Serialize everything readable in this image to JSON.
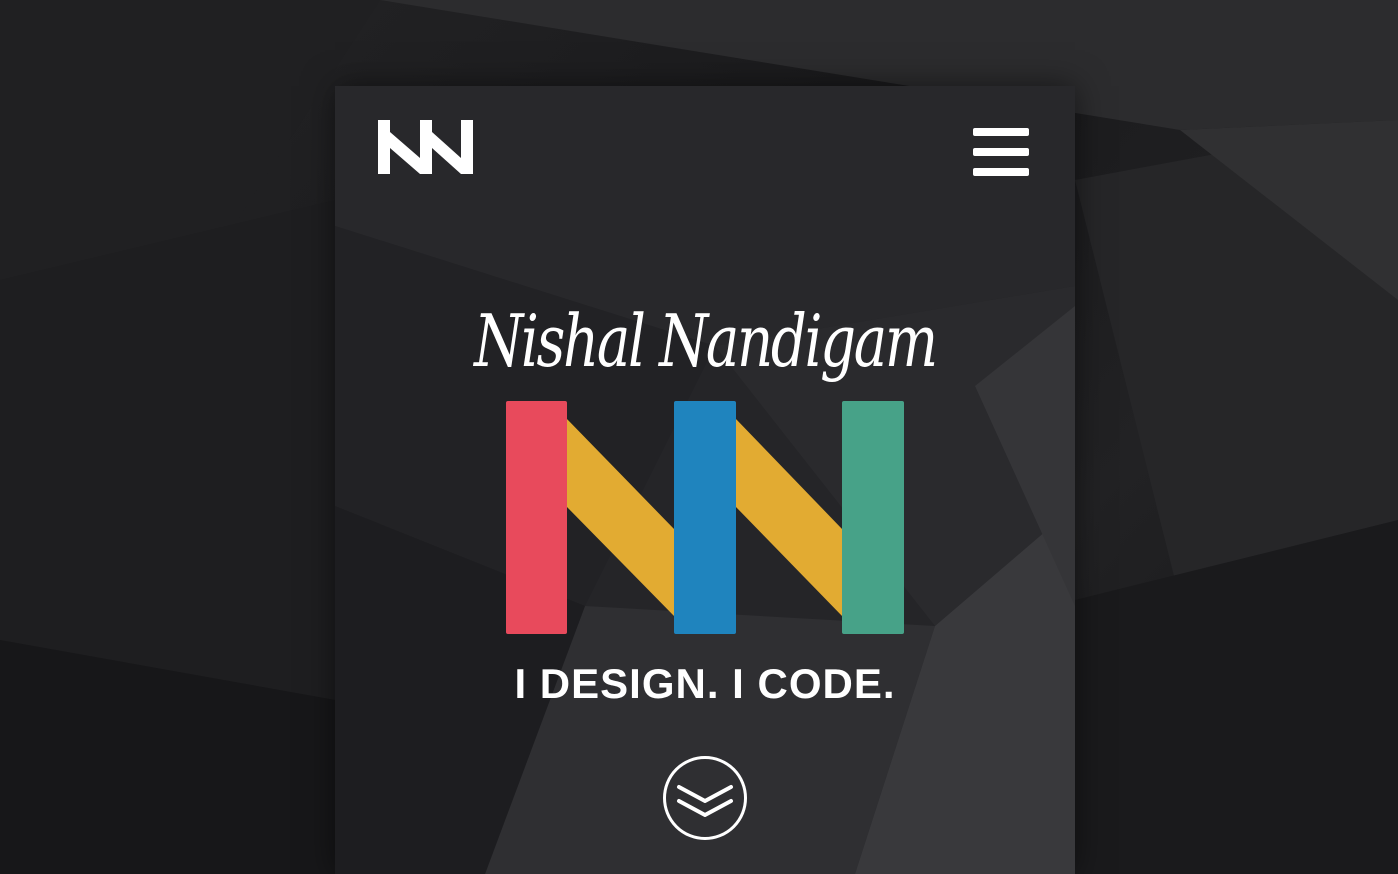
{
  "header": {
    "logo_icon": "nn-monogram-icon",
    "menu_icon": "hamburger-menu-icon"
  },
  "hero": {
    "name": "Nishal Nandigam",
    "logo_icon": "nn-colored-monogram-icon",
    "tagline": "I DESIGN. I CODE.",
    "scroll_icon": "double-chevron-down-icon"
  },
  "colors": {
    "red": "#e84a5c",
    "yellow": "#e2ab32",
    "blue": "#1f84be",
    "green": "#47a288",
    "white": "#ffffff",
    "background": "#1c1c1e"
  }
}
